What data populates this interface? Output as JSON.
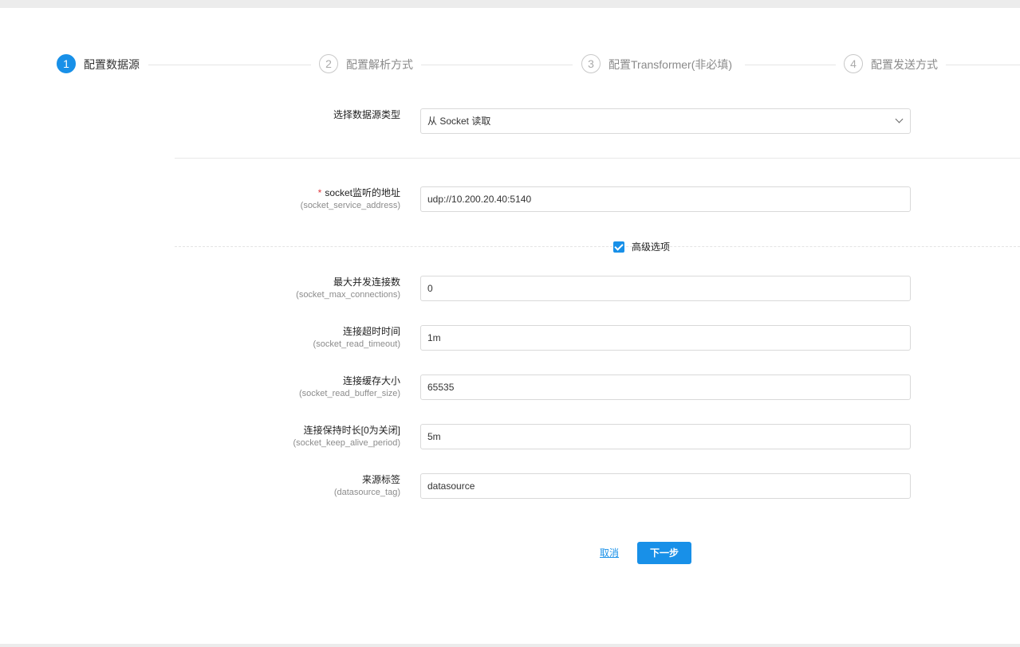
{
  "steps": [
    {
      "number": "1",
      "label": "配置数据源",
      "active": true
    },
    {
      "number": "2",
      "label": "配置解析方式",
      "active": false
    },
    {
      "number": "3",
      "label": "配置Transformer(非必填)",
      "active": false
    },
    {
      "number": "4",
      "label": "配置发送方式",
      "active": false
    }
  ],
  "source_type": {
    "label": "选择数据源类型",
    "selected": "从 Socket 读取"
  },
  "fields": {
    "address": {
      "label": "socket监听的地址",
      "key": "(socket_service_address)",
      "value": "udp://10.200.20.40:5140",
      "required_mark": "*"
    },
    "max_connections": {
      "label": "最大并发连接数",
      "key": "(socket_max_connections)",
      "value": "0"
    },
    "read_timeout": {
      "label": "连接超时时间",
      "key": "(socket_read_timeout)",
      "value": "1m"
    },
    "buffer_size": {
      "label": "连接缓存大小",
      "key": "(socket_read_buffer_size)",
      "value": "65535"
    },
    "keep_alive": {
      "label": "连接保持时长[0为关闭]",
      "key": "(socket_keep_alive_period)",
      "value": "5m"
    },
    "datasource_tag": {
      "label": "来源标签",
      "key": "(datasource_tag)",
      "value": "datasource"
    }
  },
  "advanced": {
    "label": "高级选项",
    "checked": true
  },
  "actions": {
    "cancel": "取消",
    "next": "下一步"
  },
  "colors": {
    "primary": "#1890e8",
    "required": "#e0393e"
  }
}
